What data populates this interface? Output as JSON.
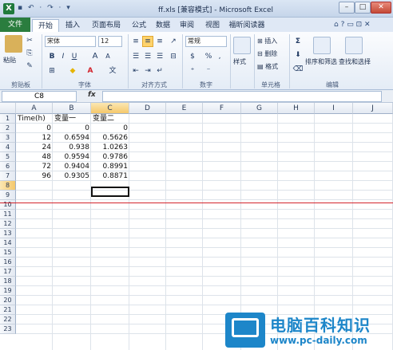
{
  "window": {
    "app_icon": "X",
    "title": "ff.xls [兼容模式] - Microsoft Excel",
    "qat": "▪ ↶ · ↷ · ▾",
    "minimize": "–",
    "maximize": "□",
    "close": "✕"
  },
  "tabs": [
    "文件",
    "开始",
    "插入",
    "页面布局",
    "公式",
    "数据",
    "审阅",
    "视图",
    "福昕阅读器"
  ],
  "tabs_right": "⌂ ? ▭ ⊡ ✕",
  "ribbon": {
    "paste_label": "粘贴",
    "font_name": "宋体",
    "font_size": "12",
    "bold": "B",
    "italic": "I",
    "underline": "U",
    "grow_font": "A",
    "shrink_font": "A",
    "number_format": "常规",
    "percent": "%",
    "comma": ",",
    "styles_label": "样式",
    "insert_label": "插入",
    "delete_label": "删除",
    "format_label": "格式",
    "sum": "Σ",
    "sort_filter_label": "排序和筛选",
    "find_select_label": "查找和选择",
    "groups": [
      "剪贴板",
      "字体",
      "对齐方式",
      "数字",
      "单元格",
      "编辑"
    ],
    "colors": {
      "file_tab": "#2a7d3e",
      "accent": "#ffd36b"
    }
  },
  "formula_bar": {
    "name_box": "C8",
    "fx": "fx",
    "content": ""
  },
  "sheet": {
    "columns": [
      "A",
      "B",
      "C",
      "D",
      "E",
      "F",
      "G",
      "H",
      "I",
      "J"
    ],
    "selected_column": "C",
    "rows": [
      "1",
      "2",
      "3",
      "4",
      "5",
      "6",
      "7",
      "8",
      "9",
      "10",
      "11",
      "12",
      "13",
      "14",
      "15",
      "16",
      "17",
      "18",
      "19",
      "20",
      "21",
      "22",
      "23"
    ],
    "selected_row": "8",
    "cells": [
      [
        "Time(h)",
        "变量一",
        "变量二"
      ],
      [
        "0",
        "0",
        "0"
      ],
      [
        "12",
        "0.6594",
        "0.5626"
      ],
      [
        "24",
        "0.938",
        "1.0263"
      ],
      [
        "48",
        "0.9594",
        "0.9786"
      ],
      [
        "72",
        "0.9404",
        "0.8991"
      ],
      [
        "96",
        "0.9305",
        "0.8871"
      ]
    ]
  },
  "watermark": {
    "title": "电脑百科知识",
    "url": "www.pc-daily.com"
  }
}
